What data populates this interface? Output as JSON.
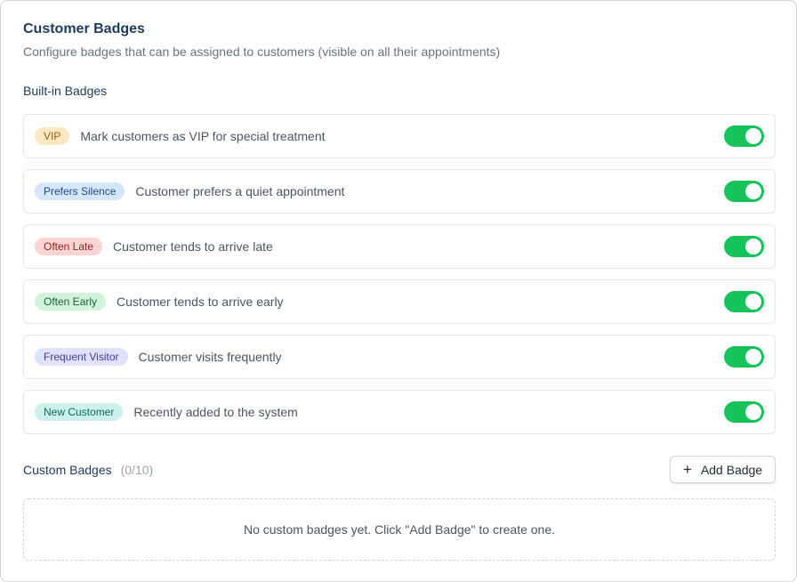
{
  "header": {
    "title": "Customer Badges",
    "subtitle": "Configure badges that can be assigned to customers (visible on all their appointments)"
  },
  "builtin": {
    "label": "Built-in Badges",
    "items": [
      {
        "badge": "VIP",
        "description": "Mark customers as VIP for special treatment",
        "bg": "#fde8c4",
        "fg": "#9a5a12",
        "enabled": true
      },
      {
        "badge": "Prefers Silence",
        "description": "Customer prefers a quiet appointment",
        "bg": "#d6e6fb",
        "fg": "#1e4e8c",
        "enabled": true
      },
      {
        "badge": "Often Late",
        "description": "Customer tends to arrive late",
        "bg": "#fbd5d5",
        "fg": "#9b1c1c",
        "enabled": true
      },
      {
        "badge": "Often Early",
        "description": "Customer tends to arrive early",
        "bg": "#d2f2dc",
        "fg": "#166534",
        "enabled": true
      },
      {
        "badge": "Frequent Visitor",
        "description": "Customer visits frequently",
        "bg": "#e0e1fb",
        "fg": "#3f3f9a",
        "enabled": true
      },
      {
        "badge": "New Customer",
        "description": "Recently added to the system",
        "bg": "#ccf1ea",
        "fg": "#0f6b5c",
        "enabled": true
      }
    ]
  },
  "custom": {
    "label": "Custom Badges",
    "count": "(0/10)",
    "add_label": "Add Badge",
    "add_icon": "plus-icon",
    "empty_text": "No custom badges yet. Click \"Add Badge\" to create one."
  },
  "colors": {
    "toggle_on": "#16c35b",
    "heading": "#1e3a5f"
  }
}
